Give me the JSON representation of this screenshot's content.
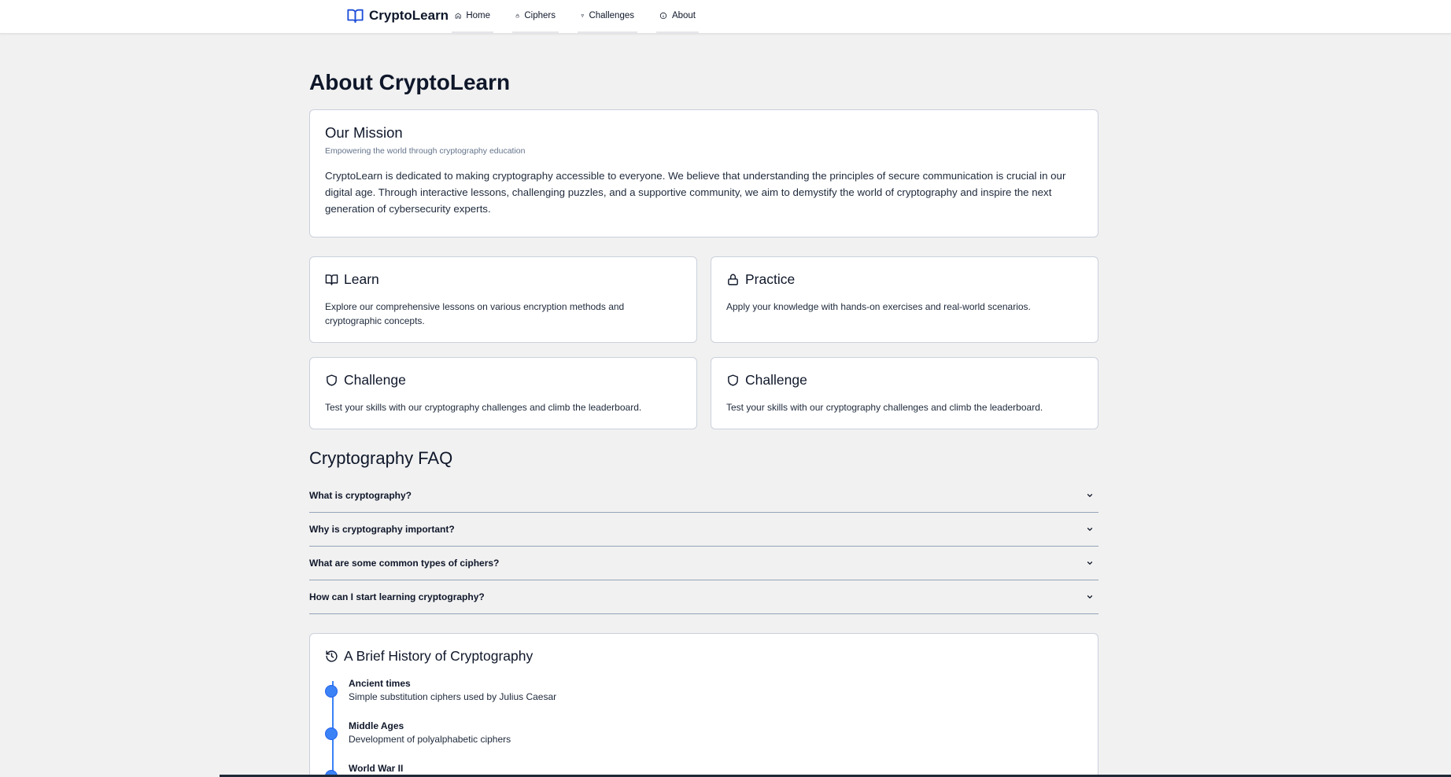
{
  "brand": {
    "name": "CryptoLearn",
    "icon": "open-book-icon",
    "accent": "#1d4ed8"
  },
  "nav": [
    {
      "label": "Home",
      "icon": "home-icon"
    },
    {
      "label": "Ciphers",
      "icon": "lock-icon"
    },
    {
      "label": "Challenges",
      "icon": "trophy-icon"
    },
    {
      "label": "About",
      "icon": "info-icon"
    }
  ],
  "page": {
    "title": "About CryptoLearn"
  },
  "mission": {
    "title": "Our Mission",
    "subtitle": "Empowering the world through cryptography education",
    "body": "CryptoLearn is dedicated to making cryptography accessible to everyone. We believe that understanding the principles of secure communication is crucial in our digital age. Through interactive lessons, challenging puzzles, and a supportive community, we aim to demystify the world of cryptography and inspire the next generation of cybersecurity experts."
  },
  "features": [
    {
      "title": "Learn",
      "icon": "open-book-icon",
      "text": "Explore our comprehensive lessons on various encryption methods and cryptographic concepts."
    },
    {
      "title": "Practice",
      "icon": "lock-icon",
      "text": "Apply your knowledge with hands-on exercises and real-world scenarios."
    },
    {
      "title": "Challenge",
      "icon": "shield-icon",
      "text": "Test your skills with our cryptography challenges and climb the leaderboard."
    },
    {
      "title": "Challenge",
      "icon": "shield-icon",
      "text": "Test your skills with our cryptography challenges and climb the leaderboard."
    }
  ],
  "faq": {
    "title": "Cryptography FAQ",
    "items": [
      {
        "question": "What is cryptography?"
      },
      {
        "question": "Why is cryptography important?"
      },
      {
        "question": "What are some common types of ciphers?"
      },
      {
        "question": "How can I start learning cryptography?"
      }
    ]
  },
  "history": {
    "title": "A Brief History of Cryptography",
    "icon": "history-icon",
    "timeline_color": "#3b82f6",
    "items": [
      {
        "era": "Ancient times",
        "description": "Simple substitution ciphers used by Julius Caesar"
      },
      {
        "era": "Middle Ages",
        "description": "Development of polyalphabetic ciphers"
      },
      {
        "era": "World War II",
        "description": ""
      }
    ]
  }
}
